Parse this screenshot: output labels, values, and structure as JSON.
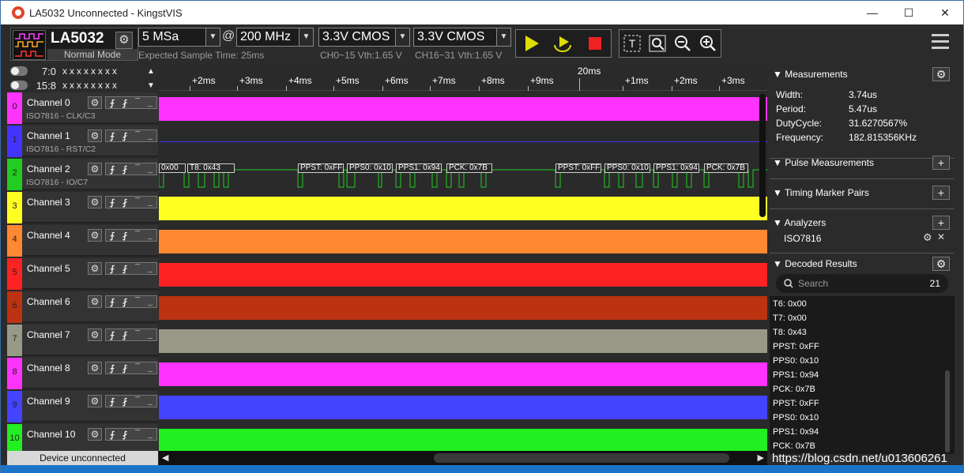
{
  "window": {
    "title": "LA5032 Unconnected - KingstVIS",
    "minimize_glyph": "—",
    "maximize_glyph": "☐",
    "close_glyph": "✕"
  },
  "toolbar": {
    "device_name": "LA5032",
    "device_mode": "Normal Mode",
    "sample_depth": "5 MSa",
    "at_symbol": "@",
    "sample_rate": "200 MHz",
    "expected_time": "Expected Sample Time: 25ms",
    "threshold_1": "3.3V CMOS",
    "threshold_1_note": "CH0~15 Vth:1.65 V",
    "threshold_2": "3.3V CMOS",
    "threshold_2_note": "CH16~31 Vth:1.65 V",
    "gear_glyph": "⚙",
    "arrow_glyph": "▼"
  },
  "ports": [
    {
      "label": "7:0",
      "bits": "xxxxxxxx",
      "arrow": "▲"
    },
    {
      "label": "15:8",
      "bits": "xxxxxxxx",
      "arrow": "▼"
    }
  ],
  "channels": [
    {
      "num": "0",
      "name": "Channel 0",
      "sub": "ISO7816 - CLK/C3",
      "color": "#ff33ff"
    },
    {
      "num": "1",
      "name": "Channel 1",
      "sub": "ISO7816 - RST/C2",
      "color": "#4433ff"
    },
    {
      "num": "2",
      "name": "Channel 2",
      "sub": "ISO7816 - IO/C7",
      "color": "#22cc22"
    },
    {
      "num": "3",
      "name": "Channel 3",
      "sub": "",
      "color": "#ffff22"
    },
    {
      "num": "4",
      "name": "Channel 4",
      "sub": "",
      "color": "#ff8833"
    },
    {
      "num": "5",
      "name": "Channel 5",
      "sub": "",
      "color": "#ff2222"
    },
    {
      "num": "6",
      "name": "Channel 6",
      "sub": "",
      "color": "#bb3311"
    },
    {
      "num": "7",
      "name": "Channel 7",
      "sub": "",
      "color": "#999988"
    },
    {
      "num": "8",
      "name": "Channel 8",
      "sub": "",
      "color": "#ff33ff"
    },
    {
      "num": "9",
      "name": "Channel 9",
      "sub": "",
      "color": "#4444ff"
    },
    {
      "num": "10",
      "name": "Channel 10",
      "sub": "",
      "color": "#22ee22"
    }
  ],
  "trigger_glyphs": {
    "rise": "⨍",
    "fall": "⨏",
    "high": "¯",
    "low": "_"
  },
  "status_text": "Device unconnected",
  "ruler": {
    "ticks": [
      "+2ms",
      "+3ms",
      "+4ms",
      "+5ms",
      "+6ms",
      "+7ms",
      "+8ms",
      "+9ms",
      "+1ms",
      "+2ms",
      "+3ms"
    ],
    "major": "20ms"
  },
  "decode_labels": [
    "0x00",
    "T8: 0x43",
    "PPST: 0xFF",
    "PPS0: 0x10",
    "PPS1: 0x94",
    "PCK: 0x7B",
    "PPST: 0xFF",
    "PPS0: 0x10",
    "PPS1: 0x94",
    "PCK: 0x7B"
  ],
  "panel": {
    "measurements_title": "Measurements",
    "width_label": "Width:",
    "width_value": "3.74us",
    "period_label": "Period:",
    "period_value": "5.47us",
    "duty_label": "DutyCycle:",
    "duty_value": "31.6270567%",
    "freq_label": "Frequency:",
    "freq_value": "182.815356KHz",
    "pulse_title": "Pulse Measurements",
    "timing_title": "Timing Marker Pairs",
    "analyzers_title": "Analyzers",
    "analyzer_name": "ISO7816",
    "decoded_title": "Decoded Results",
    "search_placeholder": "Search",
    "result_count": "21",
    "results": [
      "T6: 0x00",
      "T7: 0x00",
      "T8: 0x43",
      "PPST: 0xFF",
      "PPS0: 0x10",
      "PPS1: 0x94",
      "PCK: 0x7B",
      "PPST: 0xFF",
      "PPS0: 0x10",
      "PPS1: 0x94",
      "PCK: 0x7B"
    ],
    "plus_glyph": "+",
    "close_glyph": "✕",
    "collapse_glyph": "▼"
  },
  "watermark": "https://blog.csdn.net/u013606261",
  "scroll": {
    "left": "◀",
    "right": "▶"
  }
}
